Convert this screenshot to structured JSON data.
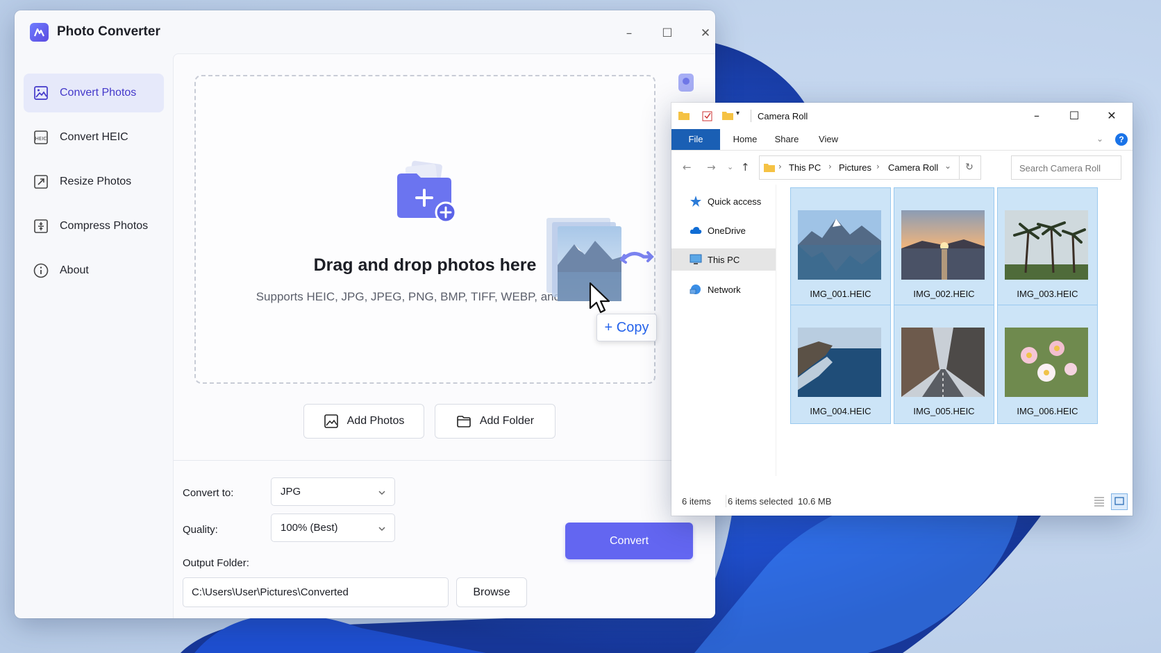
{
  "app": {
    "title": "Photo Converter",
    "window_controls": [
      "–",
      "☐",
      "✕"
    ],
    "icons": [
      "settings-icon",
      "menu-icon"
    ]
  },
  "sidebar": {
    "items": [
      {
        "label": "Convert Photos",
        "icon": "image-icon",
        "active": true
      },
      {
        "label": "Convert HEIC",
        "icon": "heic-icon",
        "active": false
      },
      {
        "label": "Resize Photos",
        "icon": "resize-icon",
        "active": false
      },
      {
        "label": "Compress Photos",
        "icon": "compress-icon",
        "active": false
      },
      {
        "label": "About",
        "icon": "info-icon",
        "active": false
      }
    ]
  },
  "dropzone": {
    "title": "Drag and drop photos here",
    "subtitle": "Supports HEIC, JPG, JPEG, PNG, BMP, TIFF, WEBP, and more.",
    "copy_tooltip": "+ Copy"
  },
  "actions": {
    "add_photos": "Add Photos",
    "add_folder": "Add Folder"
  },
  "settings": {
    "convert_to_label": "Convert to:",
    "convert_to_value": "JPG",
    "quality_label": "Quality:",
    "quality_value": "100% (Best)",
    "output_folder_label": "Output Folder:",
    "output_folder_value": "C:\\Users\\User\\Pictures\\Converted",
    "browse": "Browse",
    "convert": "Convert"
  },
  "explorer": {
    "title": "Camera Roll",
    "ribbon_tabs": [
      "File",
      "Home",
      "Share",
      "View"
    ],
    "breadcrumb": [
      "This PC",
      "Pictures",
      "Camera Roll"
    ],
    "search_placeholder": "Search Camera Roll",
    "nav": [
      {
        "label": "Quick access",
        "icon": "star-icon"
      },
      {
        "label": "OneDrive",
        "icon": "cloud-icon"
      },
      {
        "label": "This PC",
        "icon": "computer-icon",
        "selected": true
      },
      {
        "label": "Network",
        "icon": "network-icon"
      }
    ],
    "files": [
      "IMG_001.HEIC",
      "IMG_002.HEIC",
      "IMG_003.HEIC",
      "IMG_004.HEIC",
      "IMG_005.HEIC",
      "IMG_006.HEIC"
    ],
    "status": {
      "count": "6 items",
      "selected": "6 items selected",
      "size": "10.6 MB"
    }
  },
  "colors": {
    "accent": "#6366f1",
    "sidebar_active_bg": "#e6e9fa",
    "explorer_selection": "#cce4f7",
    "file_tab": "#1a5fb4"
  }
}
